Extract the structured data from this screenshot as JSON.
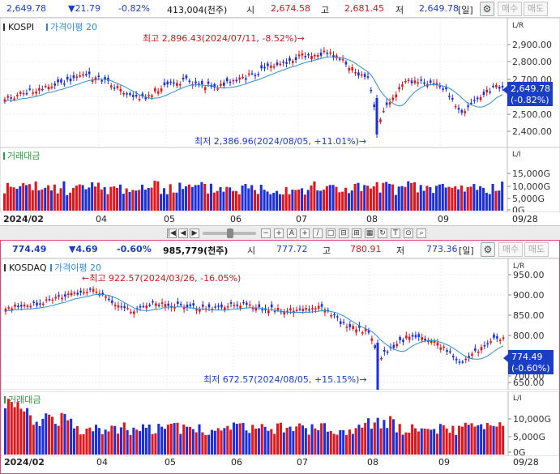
{
  "kospi": {
    "header": {
      "price": "2,649.78",
      "change": "▼21.79",
      "change_pct": "-0.82%",
      "volume": "413,004(천주)",
      "open_label": "시",
      "open_value": "2,674.58",
      "high_label": "고",
      "high_value": "2,681.45",
      "low_label": "저",
      "low_value": "2,649.78",
      "period": "[일]",
      "buy_label": "매수",
      "sell_label": "매도"
    },
    "price_chart": {
      "legend_name": "KOSPI",
      "legend_ma": "가격이평 20",
      "scale_label": "L/R",
      "y_ticks": [
        "2,900.00",
        "2,800.00",
        "2,700.00",
        "2,600.00",
        "2,500.00",
        "2,400.00"
      ],
      "high_note": "최고 2,896.43(2024/07/11, -8.52%)→",
      "low_note": "최저 2,386.96(2024/08/05, +11.01%)→",
      "current_price": "2,649.78",
      "current_pct": "(-0.82%)"
    },
    "volume_chart": {
      "legend": "거래대금",
      "scale_label": "L/I",
      "y_ticks": [
        "15,000G",
        "10,000G",
        "5,000G",
        "0G"
      ]
    },
    "x_axis": [
      "2024/02",
      "04",
      "05",
      "06",
      "07",
      "08",
      "09",
      "09/28"
    ]
  },
  "kosdaq": {
    "header": {
      "price": "774.49",
      "change": "▼4.69",
      "change_pct": "-0.60%",
      "volume": "985,779(천주)",
      "open_label": "시",
      "open_value": "777.72",
      "high_label": "고",
      "high_value": "780.91",
      "low_label": "저",
      "low_value": "773.36",
      "period": "[일]",
      "buy_label": "매수",
      "sell_label": "매도"
    },
    "price_chart": {
      "legend_name": "KOSDAQ",
      "legend_ma": "가격이평 20",
      "scale_label": "L/R",
      "y_ticks": [
        "950.00",
        "900.00",
        "850.00",
        "800.00",
        "750.00",
        "700.00",
        "650.00"
      ],
      "high_note": "←최고 922.57(2024/03/26, -16.05%)",
      "low_note": "최저 672.57(2024/08/05, +15.15%)→",
      "current_price": "774.49",
      "current_pct": "(-0.60%)"
    },
    "volume_chart": {
      "legend": "거래대금",
      "scale_label": "L/I",
      "y_ticks": [
        "10,000G",
        "5,000G",
        "0G"
      ]
    },
    "x_axis": [
      "2024/02",
      "04",
      "05",
      "06",
      "07",
      "08",
      "09",
      "09/28"
    ]
  },
  "colors": {
    "up": "#e0161c",
    "down": "#1c2fd8",
    "ma_line": "#2b8fd8",
    "panel_border": "#e0457b",
    "badge": "#1a3fc4"
  }
}
